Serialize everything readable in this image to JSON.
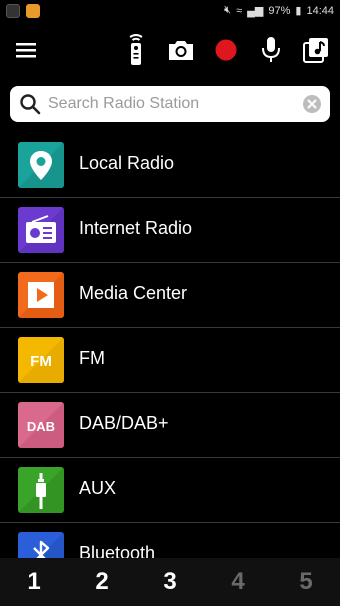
{
  "status": {
    "battery": "97%",
    "time": "14:44"
  },
  "toolbar": {
    "icons": [
      "menu-icon",
      "remote-icon",
      "camera-icon",
      "record-icon",
      "microphone-icon",
      "music-library-icon"
    ],
    "record_color": "#e0161e"
  },
  "search": {
    "placeholder": "Search Radio Station",
    "value": ""
  },
  "sources": [
    {
      "label": "Local Radio",
      "icon": "location-pin-icon",
      "color": "#1aa39a"
    },
    {
      "label": "Internet Radio",
      "icon": "radio-icon",
      "color": "#6b3bd0"
    },
    {
      "label": "Media Center",
      "icon": "play-icon",
      "color": "#f26a1b"
    },
    {
      "label": "FM",
      "icon": "fm-icon",
      "icon_text": "FM",
      "color": "#f5b800"
    },
    {
      "label": "DAB/DAB+",
      "icon": "dab-icon",
      "icon_text": "DAB",
      "color": "#d9698d"
    },
    {
      "label": "AUX",
      "icon": "aux-cable-icon",
      "color": "#3aa32a"
    },
    {
      "label": "Bluetooth",
      "icon": "bluetooth-icon",
      "color": "#2a5fd9"
    }
  ],
  "presets": [
    "1",
    "2",
    "3",
    "4",
    "5"
  ],
  "preset_active_count": 3
}
